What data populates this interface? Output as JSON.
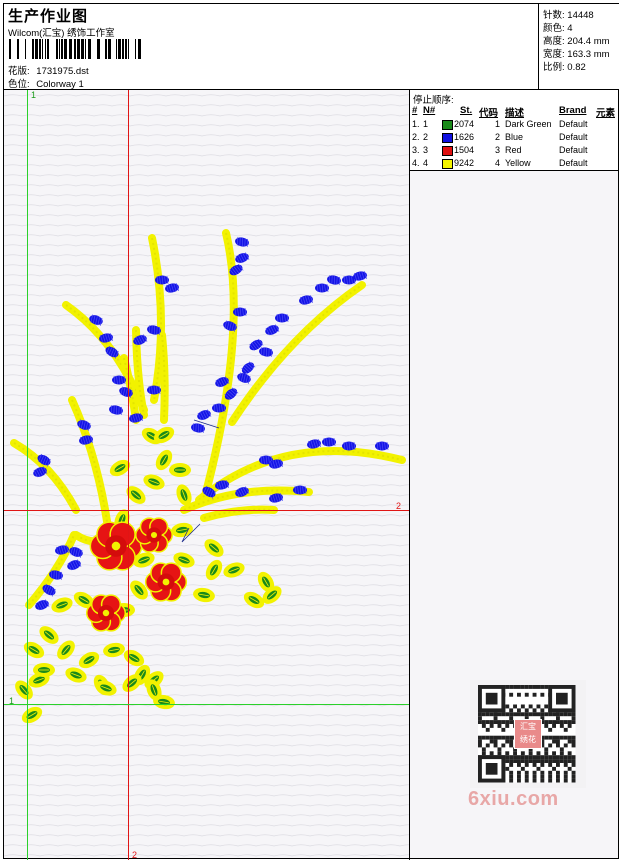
{
  "header": {
    "title": "生产作业图",
    "company": "Wilcom(汇宝) 绣饰工作室",
    "design_label": "花版:",
    "design_value": "1731975.dst",
    "colorway_label": "色位:",
    "colorway_value": "Colorway 1"
  },
  "stats": {
    "stitches_label": "针数:",
    "stitches_value": "14448",
    "colors_label": "颜色:",
    "colors_value": "4",
    "height_label": "高度:",
    "height_value": "204.4 mm",
    "width_label": "宽度:",
    "width_value": "163.3 mm",
    "scale_label": "比例:",
    "scale_value": "0.82"
  },
  "guides": {
    "h1": "1",
    "h2": "2",
    "v1": "1",
    "v2": "2"
  },
  "stop_sequence": {
    "title": "停止顺序:",
    "columns": [
      "#",
      "N#",
      "St.",
      "代码",
      "描述",
      "Brand",
      "元素"
    ],
    "rows": [
      {
        "num": "1.",
        "needle": "1",
        "stitches": "2074",
        "code": "1",
        "desc": "Dark Green",
        "brand": "Default",
        "color": "#1a8a1a"
      },
      {
        "num": "2.",
        "needle": "2",
        "stitches": "1626",
        "code": "2",
        "desc": "Blue",
        "brand": "Default",
        "color": "#1010e0"
      },
      {
        "num": "3.",
        "needle": "3",
        "stitches": "1504",
        "code": "3",
        "desc": "Red",
        "brand": "Default",
        "color": "#e01010"
      },
      {
        "num": "4.",
        "needle": "4",
        "stitches": "9242",
        "code": "4",
        "desc": "Yellow",
        "brand": "Default",
        "color": "#f5f500"
      }
    ]
  },
  "qr": {
    "badge_top": "汇宝",
    "badge_bottom": "绣花"
  },
  "watermark": "6xiu.com"
}
